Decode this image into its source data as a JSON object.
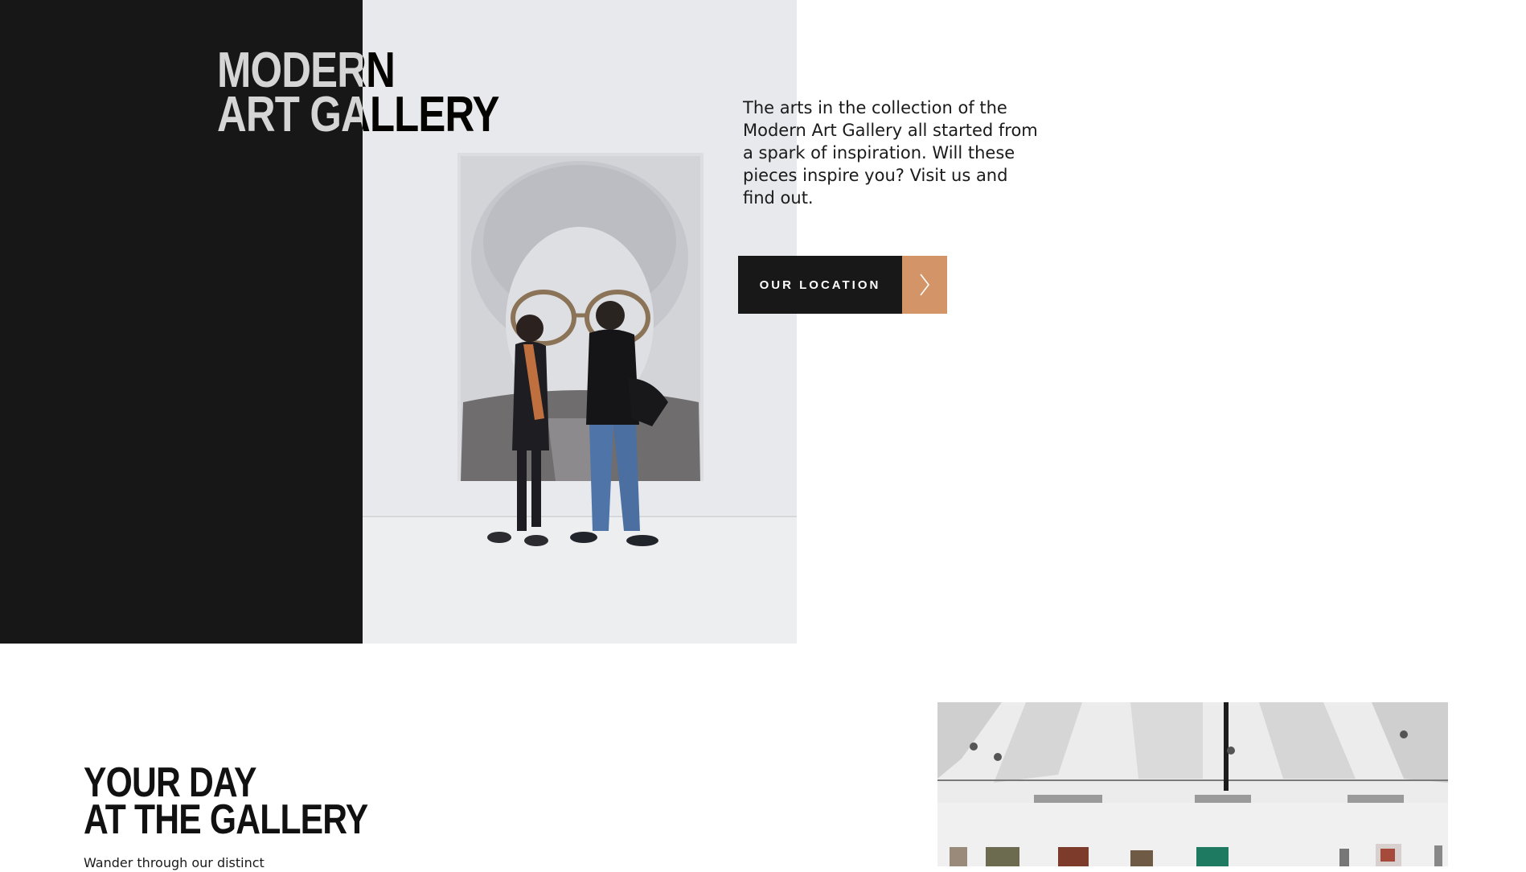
{
  "hero": {
    "title_line1": "MODERN",
    "title_line2": "ART GALLERY",
    "description": "The arts in the collection of the Modern Art Gallery all started from a spark of inspiration. Will these pieces inspire you? Visit us and find out.",
    "cta_label": "OUR LOCATION",
    "cta_icon": "chevron-right-icon"
  },
  "section_day": {
    "title_line1": "YOUR DAY",
    "title_line2": "AT THE GALLERY",
    "text": "Wander through our distinct"
  },
  "colors": {
    "dark_panel": "#171717",
    "accent": "#d39468",
    "button_dark": "#181818"
  }
}
